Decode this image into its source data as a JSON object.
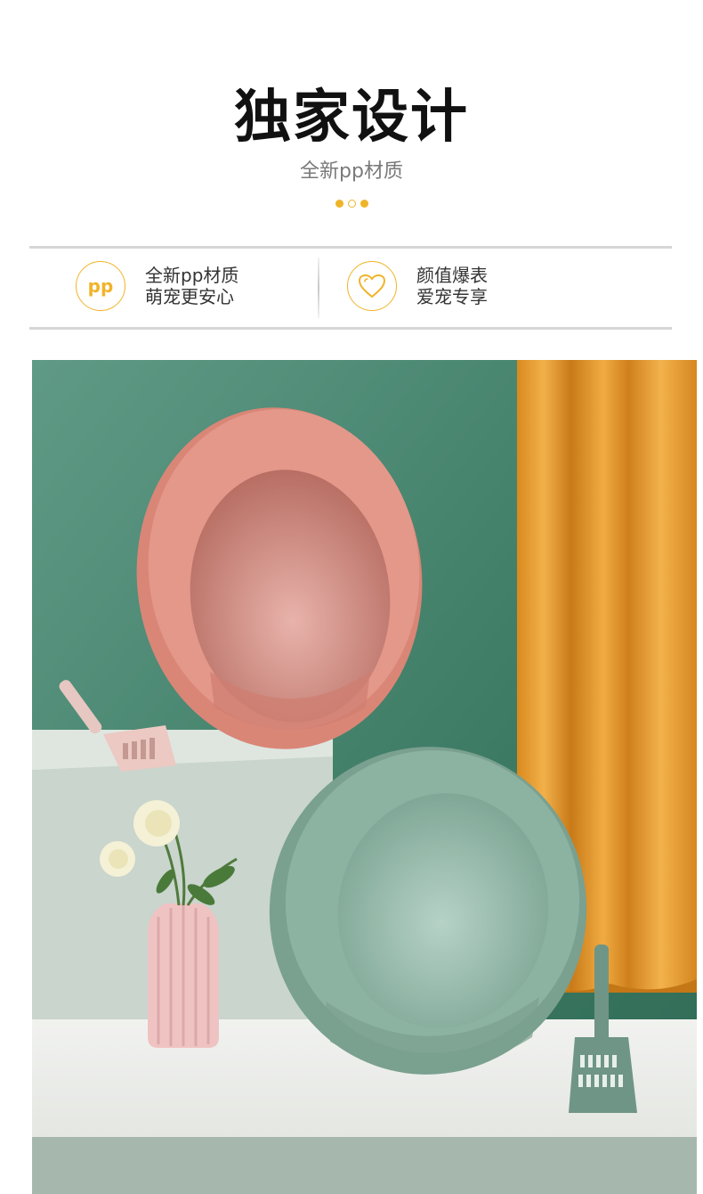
{
  "header": {
    "title": "独家设计",
    "subtitle": "全新pp材质"
  },
  "carousel": {
    "active_dots": 3
  },
  "features": [
    {
      "icon": "pp-material-icon",
      "icon_text": "pp",
      "line1": "全新pp材质",
      "line2": "萌宠更安心"
    },
    {
      "icon": "heart-icon",
      "line1": "颜值爆表",
      "line2": "爱宠专享"
    }
  ],
  "colors": {
    "accent": "#f0b429",
    "wall_green": "#3f8068",
    "curtain_orange": "#e8a030",
    "pink_litter_box": "#de8d80",
    "green_litter_box": "#86aa9a"
  }
}
